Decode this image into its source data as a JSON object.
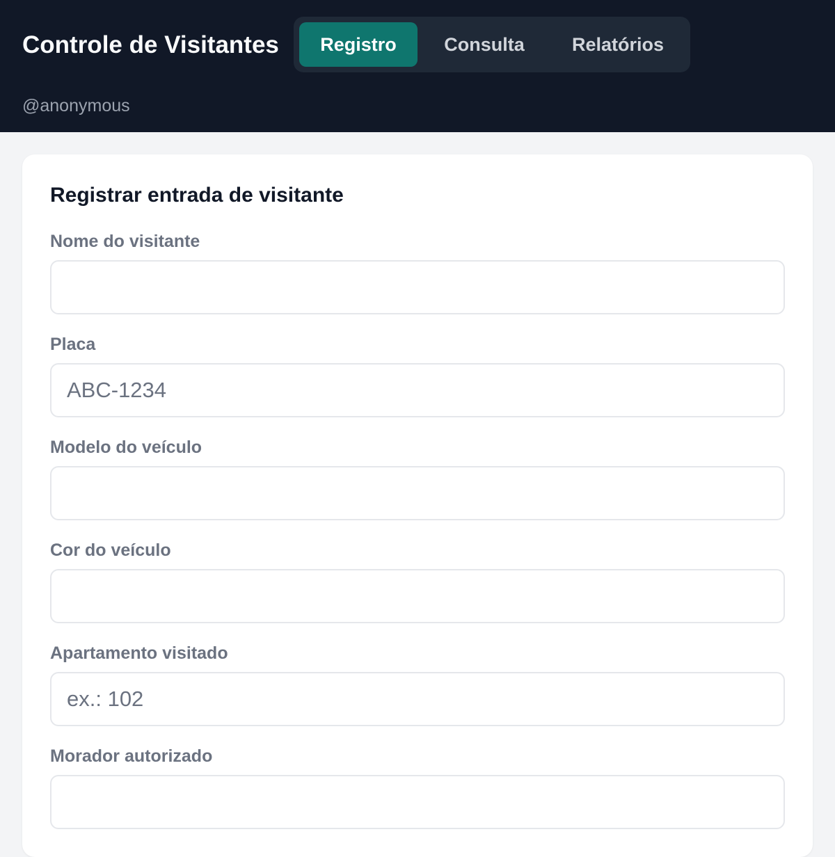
{
  "header": {
    "title": "Controle de Visitantes",
    "username": "@anonymous",
    "tabs": [
      {
        "label": "Registro",
        "active": true
      },
      {
        "label": "Consulta",
        "active": false
      },
      {
        "label": "Relatórios",
        "active": false
      }
    ]
  },
  "form": {
    "title": "Registrar entrada de visitante",
    "fields": [
      {
        "label": "Nome do visitante",
        "value": "",
        "placeholder": ""
      },
      {
        "label": "Placa",
        "value": "",
        "placeholder": "ABC-1234"
      },
      {
        "label": "Modelo do veículo",
        "value": "",
        "placeholder": ""
      },
      {
        "label": "Cor do veículo",
        "value": "",
        "placeholder": ""
      },
      {
        "label": "Apartamento visitado",
        "value": "",
        "placeholder": "ex.: 102"
      },
      {
        "label": "Morador autorizado",
        "value": "",
        "placeholder": ""
      }
    ]
  },
  "colors": {
    "header_bg": "#111827",
    "accent": "#0f766e",
    "page_bg": "#f3f4f6"
  }
}
